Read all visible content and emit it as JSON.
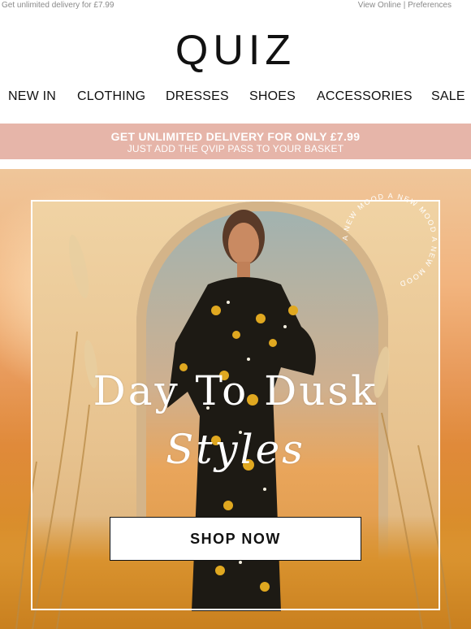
{
  "preheader": {
    "left_text": "Get unlimited delivery for £7.99",
    "view_online": "View Online",
    "separator": "|",
    "preferences": "Preferences"
  },
  "brand": {
    "logo_text": "QUIZ"
  },
  "nav": {
    "items": [
      "NEW IN",
      "CLOTHING",
      "DRESSES",
      "SHOES",
      "ACCESSORIES",
      "SALE"
    ]
  },
  "banner": {
    "line1": "GET UNLIMITED DELIVERY FOR ONLY £7.99",
    "line2": "JUST ADD THE QVIP PASS TO YOUR BASKET",
    "background": "#e6b5a9"
  },
  "hero": {
    "title_line1": "Day To Dusk",
    "title_line2": "Styles",
    "ring_text": "A NEW MOOD A NEW MOOD A NEW MOOD",
    "cta_label": "SHOP NOW"
  }
}
